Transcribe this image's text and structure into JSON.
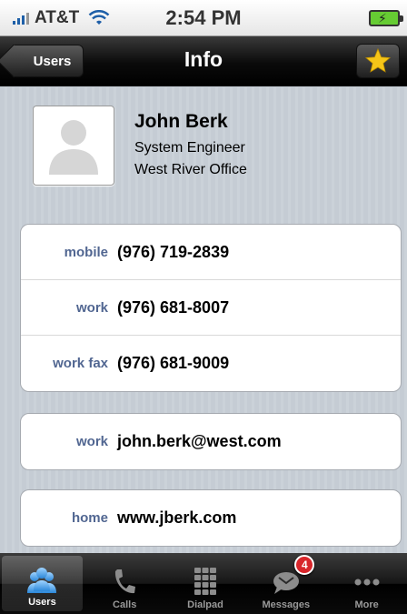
{
  "status_bar": {
    "carrier": "AT&T",
    "time": "2:54 PM"
  },
  "nav": {
    "back_label": "Users",
    "title": "Info"
  },
  "contact": {
    "name": "John Berk",
    "title": "System Engineer",
    "company": "West River Office"
  },
  "phones": [
    {
      "label": "mobile",
      "value": "(976) 719-2839"
    },
    {
      "label": "work",
      "value": "(976) 681-8007"
    },
    {
      "label": "work fax",
      "value": "(976) 681-9009"
    }
  ],
  "emails": [
    {
      "label": "work",
      "value": "john.berk@west.com"
    }
  ],
  "urls": [
    {
      "label": "home",
      "value": "www.jberk.com"
    }
  ],
  "tabs": [
    {
      "label": "Users",
      "icon": "users-icon",
      "active": true
    },
    {
      "label": "Calls",
      "icon": "phone-icon"
    },
    {
      "label": "Dialpad",
      "icon": "dialpad-icon"
    },
    {
      "label": "Messages",
      "icon": "messages-icon",
      "badge": "4"
    },
    {
      "label": "More",
      "icon": "more-icon"
    }
  ],
  "colors": {
    "row_label": "#516691",
    "badge": "#d8262b",
    "star": "#f5c518",
    "background": "#c5ccd4"
  }
}
